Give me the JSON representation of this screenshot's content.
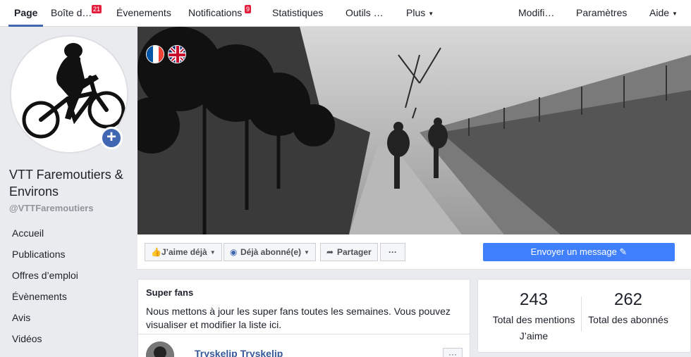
{
  "topnav": {
    "tabs": [
      {
        "label": "Page",
        "active": true
      },
      {
        "label": "Boîte d…",
        "badge": "21"
      },
      {
        "label": "Évenements"
      },
      {
        "label": "Notifications",
        "badge": "9"
      },
      {
        "label": "Statistiques"
      },
      {
        "label": "Outils …"
      },
      {
        "label": "Plus",
        "caret": true
      },
      {
        "label": "Modifi…"
      },
      {
        "label": "Paramètres"
      },
      {
        "label": "Aide",
        "caret": true
      }
    ]
  },
  "sidebar": {
    "page_name": "VTT Faremoutiers & Environs",
    "handle": "@VTTFaremoutiers",
    "add_icon": "+",
    "items": [
      "Accueil",
      "Publications",
      "Offres d’emploi",
      "Évènements",
      "Avis",
      "Vidéos"
    ]
  },
  "actions": {
    "like_label": "J’aime déjà",
    "subscribe_label": "Déjà abonné(e)",
    "share_label": "Partager",
    "more_label": "···",
    "message_label": "Envoyer un message ✎"
  },
  "superfans": {
    "title": "Super fans",
    "description": "Nous mettons à jour les super fans toutes les semaines. Vous pouvez visualiser et modifier la liste ici.",
    "first_fan": "Tryskelip Tryskelip",
    "more_label": "···"
  },
  "stats": {
    "likes_count": "243",
    "likes_label": "Total des mentions J’aime",
    "followers_count": "262",
    "followers_label": "Total des abonnés"
  },
  "colors": {
    "accent": "#4267b2",
    "primary_button": "#4080ff",
    "badge": "#e41e3f"
  }
}
